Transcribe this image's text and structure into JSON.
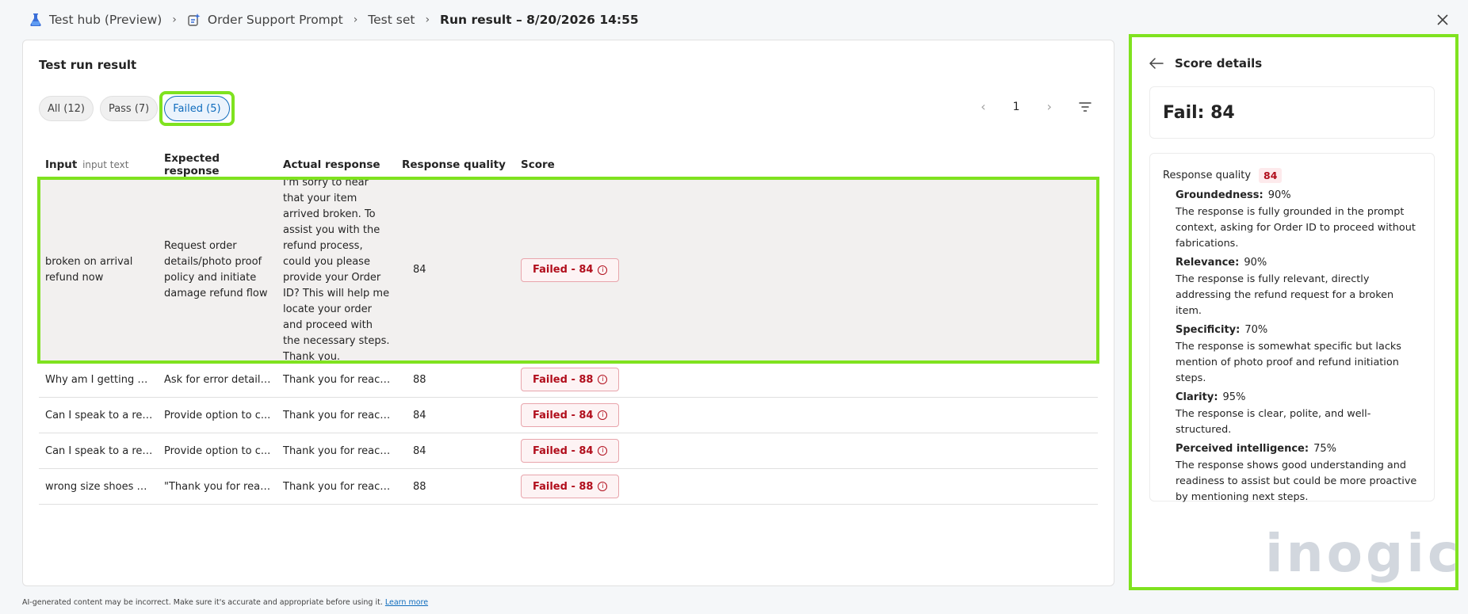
{
  "breadcrumb": {
    "items": [
      {
        "label": "Test hub (Preview)",
        "icon": "flask-icon"
      },
      {
        "label": "Order Support Prompt",
        "icon": "prompt-icon"
      },
      {
        "label": "Test set"
      },
      {
        "label": "Run result – 8/20/2026 14:55"
      }
    ]
  },
  "main": {
    "title": "Test run result",
    "filters": [
      {
        "label": "All (12)"
      },
      {
        "label": "Pass (7)"
      },
      {
        "label": "Failed (5)"
      }
    ],
    "pager": {
      "page": "1"
    },
    "table": {
      "headers": {
        "input": "Input",
        "input_sub": "input text",
        "expected": "Expected response",
        "actual": "Actual response",
        "quality": "Response quality",
        "score": "Score"
      },
      "rows": [
        {
          "input": "broken on arrival refund now",
          "expected": "Request order details/photo proof policy and initiate damage refund flow",
          "actual": "I'm sorry to hear that your item arrived broken. To assist you with the refund process, could you please provide your Order ID? This will help me locate your order and proceed with the necessary steps. Thank you.",
          "quality": "84",
          "score": "Failed - 84"
        },
        {
          "input": "Why am I getting a...",
          "expected": "Ask for error details...",
          "actual": "Thank you for reach...",
          "quality": "88",
          "score": "Failed - 88"
        },
        {
          "input": "Can I speak to a rep...",
          "expected": "Provide option to c...",
          "actual": "Thank you for reach...",
          "quality": "84",
          "score": "Failed - 84"
        },
        {
          "input": "Can I speak to a rep...",
          "expected": "Provide option to c...",
          "actual": "Thank you for reach...",
          "quality": "84",
          "score": "Failed - 84"
        },
        {
          "input": "wrong size shoes w...",
          "expected": "\"Thank you for reac...",
          "actual": "Thank you for reach...",
          "quality": "88",
          "score": "Failed - 88"
        }
      ]
    }
  },
  "score_panel": {
    "title": "Score details",
    "fail_label": "Fail: 84",
    "response_quality_label": "Response quality",
    "response_quality_value": "84",
    "metrics": [
      {
        "name": "Groundedness:",
        "pct": "90%",
        "desc": "The response is fully grounded in the prompt context, asking for Order ID to proceed without fabrications."
      },
      {
        "name": "Relevance:",
        "pct": "90%",
        "desc": "The response is fully relevant, directly addressing the refund request for a broken item."
      },
      {
        "name": "Specificity:",
        "pct": "70%",
        "desc": "The response is somewhat specific but lacks mention of photo proof and refund initiation steps."
      },
      {
        "name": "Clarity:",
        "pct": "95%",
        "desc": "The response is clear, polite, and well-structured."
      },
      {
        "name": "Perceived intelligence:",
        "pct": "75%",
        "desc": "The response shows good understanding and readiness to assist but could be more proactive by mentioning next steps."
      }
    ]
  },
  "watermark": "inogic",
  "footer": {
    "text": "AI-generated content may be incorrect. Make sure it's accurate and appropriate before using it.",
    "link": "Learn more"
  },
  "colors": {
    "accent": "#0f6cbd",
    "fail": "#b10e1c",
    "highlight": "#7fe21f"
  }
}
